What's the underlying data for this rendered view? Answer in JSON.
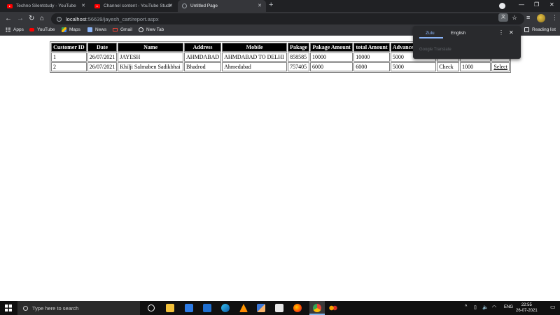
{
  "browser": {
    "tabs": [
      {
        "title": "Techno Silentstudy - YouTube",
        "icon": "youtube-icon"
      },
      {
        "title": "Channel content - YouTube Studio",
        "icon": "youtube-icon"
      },
      {
        "title": "Untitled Page",
        "icon": "globe-icon"
      }
    ],
    "url_host": "localhost",
    "url_path": ":56639/jayesh_cart/report.aspx",
    "bookmarks": [
      "Apps",
      "YouTube",
      "Maps",
      "News",
      "Gmail",
      "New Tab"
    ],
    "reading_list": "Reading list"
  },
  "translate_popup": {
    "lang_from": "Zulu",
    "lang_to": "English",
    "footer": "Google Translate"
  },
  "report": {
    "headers": [
      "Customer ID",
      "Date",
      "Name",
      "Address",
      "Mobile",
      "Pakage",
      "Pakage Amount",
      "total Amount",
      "Advance Amount",
      "",
      "",
      ""
    ],
    "rows": [
      [
        "1",
        "26/07/2021",
        "JAYESH",
        "AHMDABAD",
        "AHMDABAD TO DELHI",
        "858585",
        "10000",
        "10000",
        "5000",
        "",
        "",
        ""
      ],
      [
        "2",
        "26/07/2021",
        "Khilji Salmaben Sadikbhai",
        "Bhadrod",
        "Ahmedabad",
        "757405",
        "6000",
        "6000",
        "5000",
        "Check",
        "1000",
        "Select"
      ]
    ]
  },
  "taskbar": {
    "search_placeholder": "Type here to search",
    "language": "ENG",
    "time": "22:55",
    "date": "26-07-2021"
  }
}
